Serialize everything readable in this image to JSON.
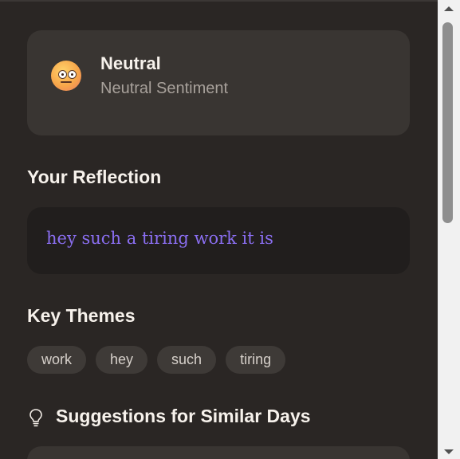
{
  "sentiment": {
    "icon": "neutral-face-emoji-icon",
    "title": "Neutral",
    "subtitle": "Neutral Sentiment"
  },
  "reflection": {
    "heading": "Your Reflection",
    "text": "hey such a tiring work it is"
  },
  "themes": {
    "heading": "Key Themes",
    "items": [
      "work",
      "hey",
      "such",
      "tiring"
    ]
  },
  "suggestions": {
    "icon": "lightbulb-icon",
    "heading": "Suggestions for Similar Days"
  },
  "colors": {
    "background": "#2a2624",
    "card": "#393532",
    "reflection_text": "#8a6ef0",
    "chip": "#3e3a37"
  }
}
